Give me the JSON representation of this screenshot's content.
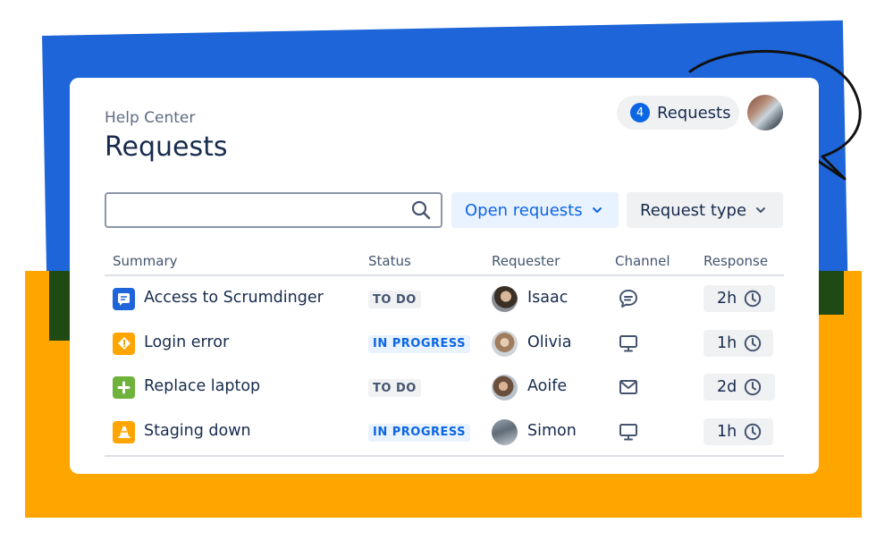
{
  "header": {
    "breadcrumb": "Help Center",
    "title": "Requests",
    "requests_count": "4",
    "requests_label": "Requests"
  },
  "search": {
    "value": "",
    "placeholder": ""
  },
  "filters": {
    "status": "Open requests",
    "type": "Request type"
  },
  "table": {
    "columns": [
      "Summary",
      "Status",
      "Requester",
      "Channel",
      "Response"
    ],
    "rows": [
      {
        "summary": "Access to Scrumdinger",
        "type_icon": "chat-square-icon",
        "type_color": "#1d65d8",
        "status": "TO DO",
        "requester": "Isaac",
        "channel": "chat-icon",
        "response": "2h"
      },
      {
        "summary": "Login error",
        "type_icon": "warning-icon",
        "type_color": "#ffa500",
        "status": "IN PROGRESS",
        "requester": "Olivia",
        "channel": "monitor-icon",
        "response": "1h"
      },
      {
        "summary": "Replace laptop",
        "type_icon": "plus-icon",
        "type_color": "#6fb33c",
        "status": "TO DO",
        "requester": "Aoife",
        "channel": "email-icon",
        "response": "2d"
      },
      {
        "summary": "Staging down",
        "type_icon": "cone-icon",
        "type_color": "#ffa500",
        "status": "IN PROGRESS",
        "requester": "Simon",
        "channel": "monitor-icon",
        "response": "1h"
      }
    ]
  },
  "colors": {
    "primary_blue": "#0c66e4",
    "brand_blue": "#1d65d8",
    "orange": "#ffa500",
    "text": "#172b4d"
  }
}
